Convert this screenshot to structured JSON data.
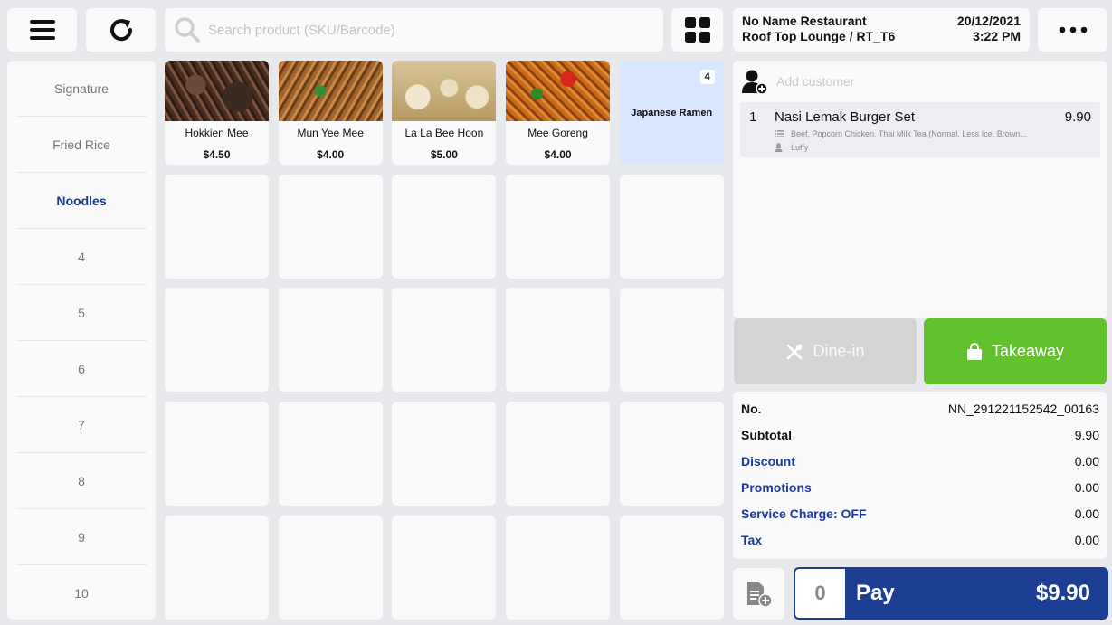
{
  "search": {
    "placeholder": "Search product (SKU/Barcode)"
  },
  "header": {
    "restaurant": "No Name Restaurant",
    "date": "20/12/2021",
    "table": "Roof Top Lounge / RT_T6",
    "time": "3:22 PM"
  },
  "categories": [
    "Signature",
    "Fried Rice",
    "Noodles",
    "4",
    "5",
    "6",
    "7",
    "8",
    "9",
    "10"
  ],
  "active_category": "Noodles",
  "products": [
    {
      "name": "Hokkien Mee",
      "price": "$4.50"
    },
    {
      "name": "Mun Yee Mee",
      "price": "$4.00"
    },
    {
      "name": "La La Bee Hoon",
      "price": "$5.00"
    },
    {
      "name": "Mee Goreng",
      "price": "$4.00"
    }
  ],
  "folder": {
    "name": "Japanese Ramen",
    "count": "4"
  },
  "customer": {
    "placeholder": "Add customer"
  },
  "order_items": [
    {
      "qty": "1",
      "name": "Nasi Lemak Burger Set",
      "price": "9.90",
      "modifiers": "Beef, Popcorn Chicken, Thai Milk Tea (Normal, Less Ice, Brown...",
      "staff": "Luffy"
    }
  ],
  "order_type": {
    "dine_in": "Dine-in",
    "takeaway": "Takeaway"
  },
  "totals": {
    "no_label": "No.",
    "no_value": "NN_291221152542_00163",
    "subtotal_label": "Subtotal",
    "subtotal_value": "9.90",
    "discount_label": "Discount",
    "discount_value": "0.00",
    "promotions_label": "Promotions",
    "promotions_value": "0.00",
    "service_label": "Service Charge: OFF",
    "service_value": "0.00",
    "tax_label": "Tax",
    "tax_value": "0.00"
  },
  "pay": {
    "count": "0",
    "label": "Pay",
    "amount": "$9.90"
  },
  "colors": {
    "accent": "#1d3f93",
    "takeaway": "#62c22e",
    "folder": "#d8e6ff",
    "link": "#1a3aa0"
  },
  "icons": [
    "menu-icon",
    "refresh-icon",
    "search-icon",
    "grid-icon",
    "more-icon",
    "add-customer-icon",
    "list-icon",
    "chef-icon",
    "cutlery-icon",
    "bag-icon",
    "add-note-icon"
  ]
}
